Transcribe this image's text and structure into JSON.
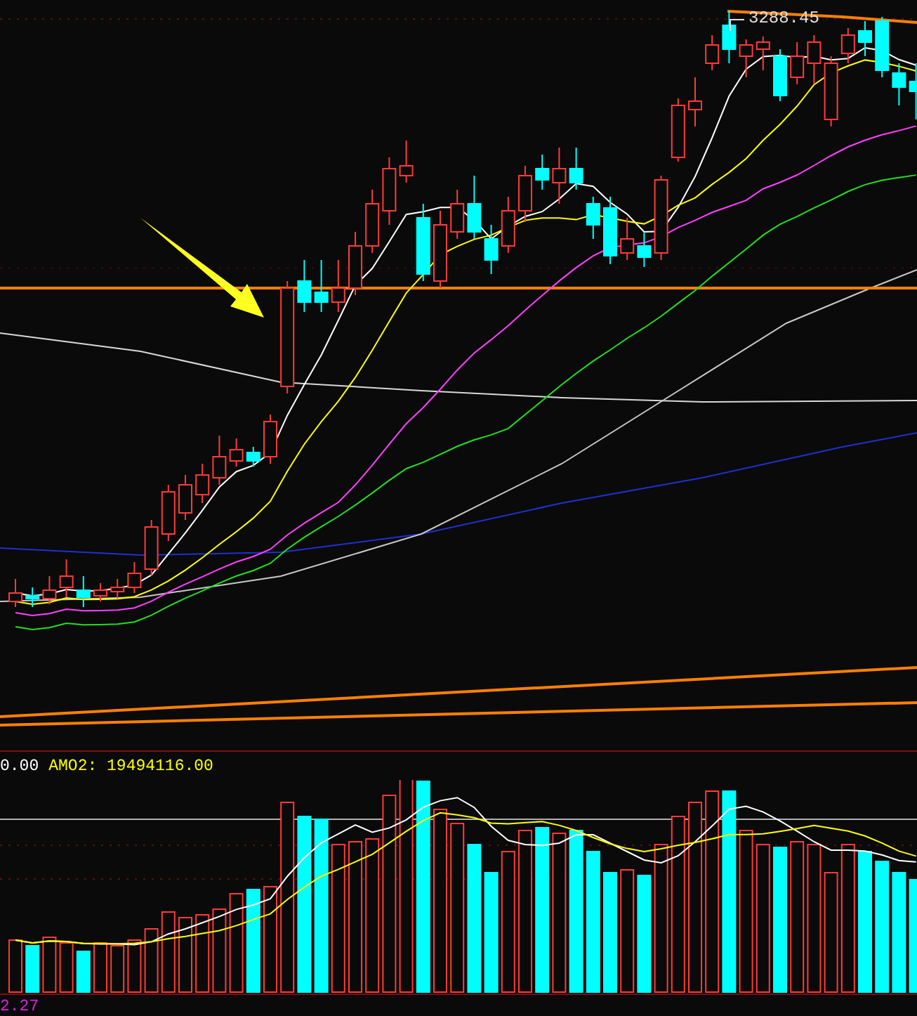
{
  "price_panel": {
    "max_price_label": "3288.45"
  },
  "volume_panel": {
    "indicator_values": [
      {
        "text": "0.00",
        "color": "#ffffff"
      },
      {
        "text": "AMO2: 19494116.00",
        "color": "#ffff00"
      }
    ]
  },
  "axis_label": "2.27"
}
